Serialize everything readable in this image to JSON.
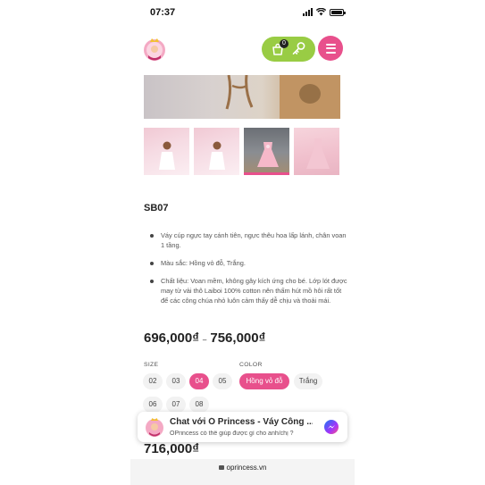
{
  "status_bar": {
    "time": "07:37"
  },
  "header": {
    "cart_count": "0",
    "colors": {
      "cart_pill": "#99cc44",
      "menu": "#e8508c"
    }
  },
  "product": {
    "sku": "SB07",
    "description": [
      "Váy cúp ngực tay cánh tiên, ngực thêu hoa lấp lánh, chân voan 1 tầng.",
      "Màu sắc: Hồng vỏ đỗ, Trắng.",
      "Chất liệu: Voan mềm, không gây kích ứng cho bé. Lớp lót được may từ vải thô Laiboi 100% cotton nên thấm hút mồ hôi rất tốt để các công chúa nhỏ luôn cảm thấy dễ chịu và thoải mái."
    ],
    "price_min": "696,000₫",
    "price_sep": "–",
    "price_max": "756,000₫",
    "size_label": "SIZE",
    "sizes": [
      "02",
      "03",
      "04",
      "05",
      "06",
      "07",
      "08"
    ],
    "selected_size": "04",
    "color_label": "COLOR",
    "colors": [
      "Hồng vỏ đỗ",
      "Trắng"
    ],
    "selected_color": "Hồng vỏ đỗ",
    "current_price": "716,000₫"
  },
  "chat": {
    "title": "Chat với Ó Princess - Váy Công ...",
    "subtitle": "OPrincess có thể giúp được gì cho anh/chị ?"
  },
  "browser": {
    "url": "oprincess.vn"
  },
  "accent_color": "#e8508c"
}
